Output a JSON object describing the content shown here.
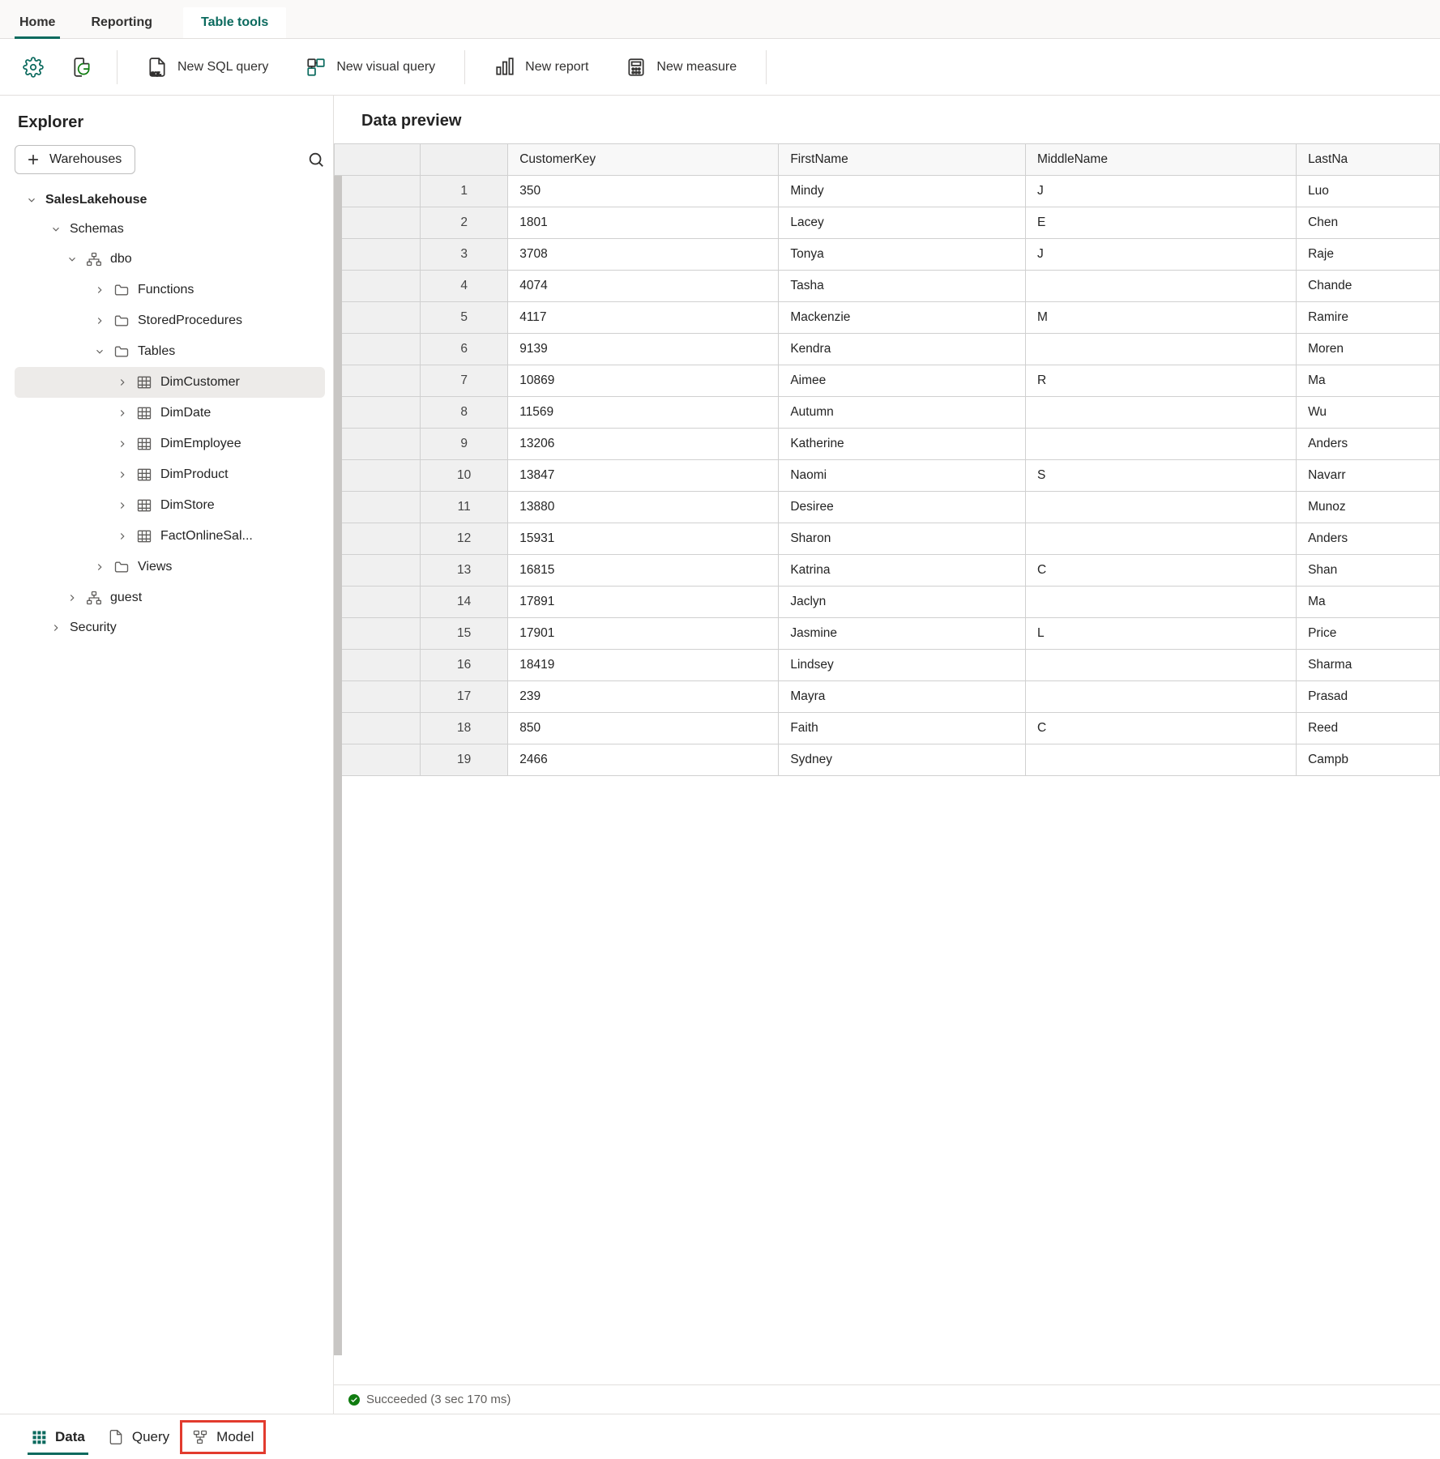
{
  "ribbon": {
    "tabs": [
      "Home",
      "Reporting",
      "Table tools"
    ],
    "commands": {
      "settings": "",
      "refresh": "",
      "new_sql": "New SQL query",
      "new_visual": "New visual query",
      "new_report": "New report",
      "new_measure": "New measure"
    }
  },
  "explorer": {
    "title": "Explorer",
    "add_warehouses": "Warehouses",
    "root": "SalesLakehouse",
    "schemas_label": "Schemas",
    "dbo_label": "dbo",
    "folders": {
      "functions": "Functions",
      "sprocs": "StoredProcedures",
      "tables": "Tables",
      "views": "Views"
    },
    "tables": [
      "DimCustomer",
      "DimDate",
      "DimEmployee",
      "DimProduct",
      "DimStore",
      "FactOnlineSal..."
    ],
    "guest_label": "guest",
    "security_label": "Security"
  },
  "preview": {
    "title": "Data preview",
    "columns": [
      "CustomerKey",
      "FirstName",
      "MiddleName",
      "LastNa"
    ],
    "rows": [
      [
        "350",
        "Mindy",
        "J",
        "Luo"
      ],
      [
        "1801",
        "Lacey",
        "E",
        "Chen"
      ],
      [
        "3708",
        "Tonya",
        "J",
        "Raje"
      ],
      [
        "4074",
        "Tasha",
        "",
        "Chande"
      ],
      [
        "4117",
        "Mackenzie",
        "M",
        "Ramire"
      ],
      [
        "9139",
        "Kendra",
        "",
        "Moren"
      ],
      [
        "10869",
        "Aimee",
        "R",
        "Ma"
      ],
      [
        "11569",
        "Autumn",
        "",
        "Wu"
      ],
      [
        "13206",
        "Katherine",
        "",
        "Anders"
      ],
      [
        "13847",
        "Naomi",
        "S",
        "Navarr"
      ],
      [
        "13880",
        "Desiree",
        "",
        "Munoz"
      ],
      [
        "15931",
        "Sharon",
        "",
        "Anders"
      ],
      [
        "16815",
        "Katrina",
        "C",
        "Shan"
      ],
      [
        "17891",
        "Jaclyn",
        "",
        "Ma"
      ],
      [
        "17901",
        "Jasmine",
        "L",
        "Price"
      ],
      [
        "18419",
        "Lindsey",
        "",
        "Sharma"
      ],
      [
        "239",
        "Mayra",
        "",
        "Prasad"
      ],
      [
        "850",
        "Faith",
        "C",
        "Reed"
      ],
      [
        "2466",
        "Sydney",
        "",
        "Campb"
      ]
    ],
    "status": "Succeeded (3 sec 170 ms)"
  },
  "view_tabs": {
    "data": "Data",
    "query": "Query",
    "model": "Model"
  }
}
